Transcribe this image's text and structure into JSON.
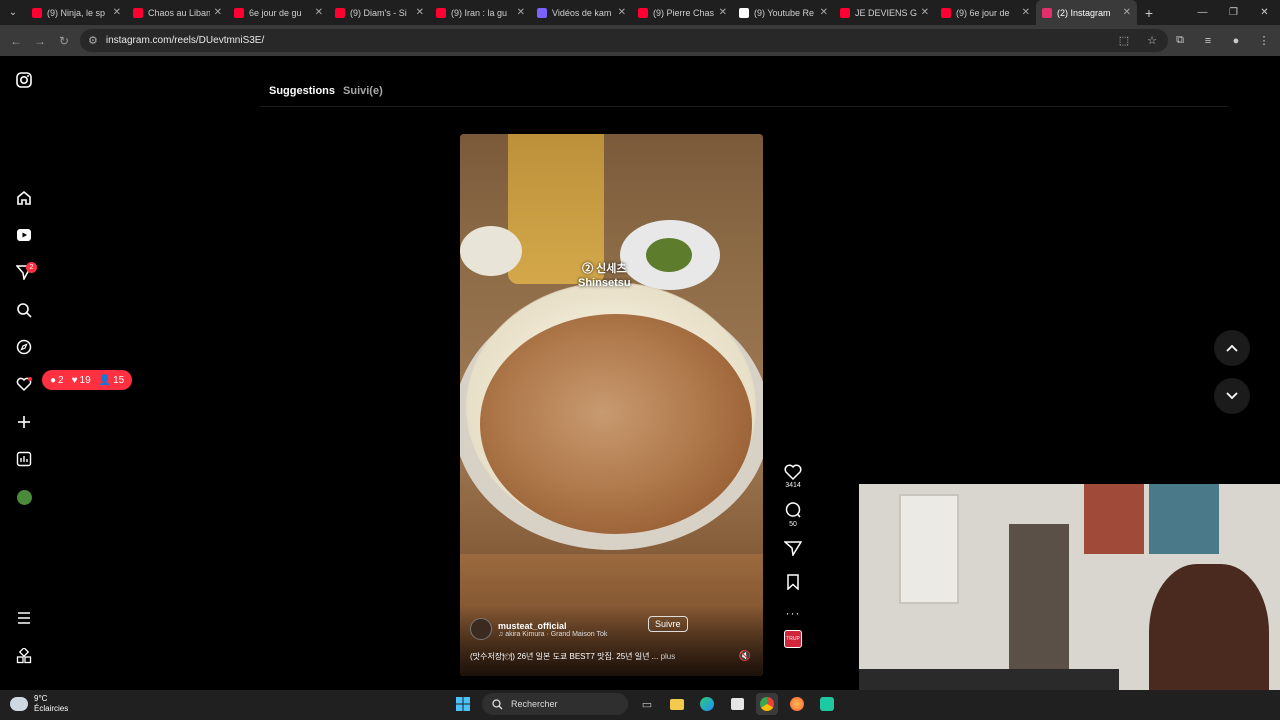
{
  "browser": {
    "tabs": [
      {
        "title": "(9) Ninja, le sp",
        "fav": "#ff0033"
      },
      {
        "title": "Chaos au Liban",
        "fav": "#ff0033"
      },
      {
        "title": "6e jour de gu",
        "fav": "#ff0033"
      },
      {
        "title": "(9) Diam's - Si",
        "fav": "#ff0033"
      },
      {
        "title": "(9) Iran : la gu",
        "fav": "#ff0033"
      },
      {
        "title": "Vidéos de kam",
        "fav": "#7b61ff"
      },
      {
        "title": "(9) Pierre Chas",
        "fav": "#ff0033"
      },
      {
        "title": "(9) Youtube Re",
        "fav": "#ffffff"
      },
      {
        "title": "JE DEVIENS GY",
        "fav": "#ff0033"
      },
      {
        "title": "(9) 6e jour de",
        "fav": "#ff0033"
      },
      {
        "title": "(2) Instagram",
        "fav": "#e1306c",
        "active": true
      }
    ],
    "url": "instagram.com/reels/DUevtmniS3E/"
  },
  "feed": {
    "tab_suggestions": "Suggestions",
    "tab_following": "Suivi(e)"
  },
  "notifications": {
    "nav_badge": "2",
    "comments": "2",
    "likes": "19",
    "follows": "15"
  },
  "reel": {
    "overlay_text_line1": "② 신세츠",
    "overlay_text_line2": "Shinsetsu",
    "username": "musteat_official",
    "music": "♫ akira Kimura · Grand Maison Tok",
    "follow_label": "Suivre",
    "description": "(맛수저장🍽) 26년 일본 도쿄 BEST7 맛집. 25년 일년 ...",
    "more_label": "plus",
    "likes": "3414",
    "comments": "50",
    "thumb_label": "TRUP"
  },
  "taskbar": {
    "temp": "9°C",
    "weather": "Éclaircies",
    "search_label": "Rechercher"
  },
  "colors": {
    "badge": "#ff3040",
    "background": "#000000"
  }
}
